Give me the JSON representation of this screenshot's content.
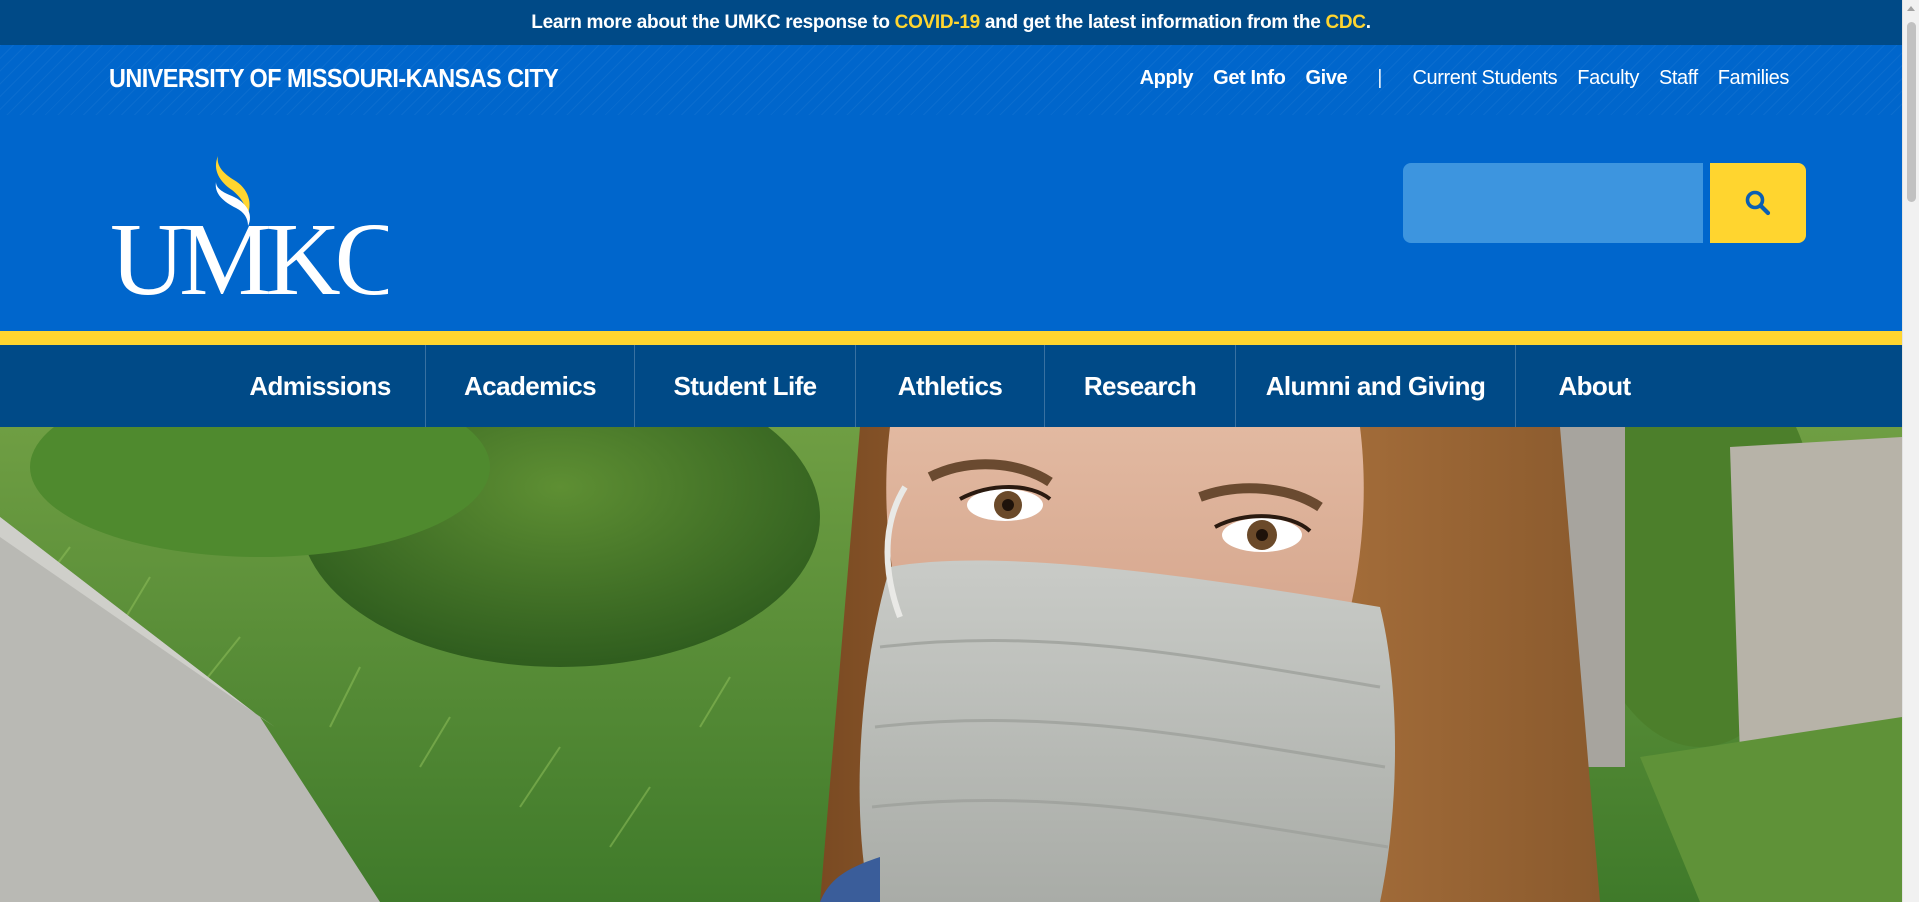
{
  "alert": {
    "prefix": "Learn more about the UMKC response to ",
    "covid_link": "COVID-19",
    "middle": " and get the latest information from the ",
    "cdc_link": "CDC",
    "suffix": "."
  },
  "utility": {
    "site_name": "UNIVERSITY OF MISSOURI-KANSAS CITY",
    "primary_links": [
      "Apply",
      "Get Info",
      "Give"
    ],
    "separator": "|",
    "audience_links": [
      "Current Students",
      "Faculty",
      "Staff",
      "Families"
    ]
  },
  "header": {
    "logo_text": "UMKC",
    "search": {
      "value": "",
      "placeholder": ""
    },
    "search_icon": "search-icon"
  },
  "nav": {
    "items": [
      "Admissions",
      "Academics",
      "Student Life",
      "Athletics",
      "Research",
      "Alumni and Giving",
      "About"
    ]
  },
  "colors": {
    "brand_blue": "#0066cc",
    "dark_blue": "#004a87",
    "gold": "#ffd52f",
    "search_field": "#3d95df"
  }
}
